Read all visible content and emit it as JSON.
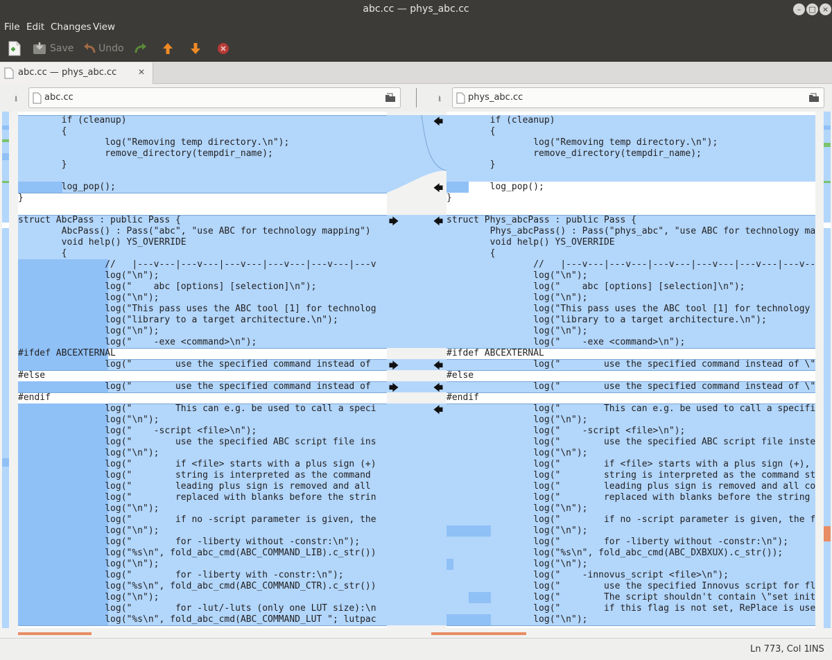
{
  "window": {
    "title": "abc.cc — phys_abc.cc"
  },
  "menu": {
    "file": "File",
    "edit": "Edit",
    "changes": "Changes",
    "view": "View"
  },
  "toolbar": {
    "save": "Save",
    "undo": "Undo"
  },
  "tab": {
    "label": "abc.cc — phys_abc.cc"
  },
  "left_file": {
    "name": "abc.cc"
  },
  "right_file": {
    "name": "phys_abc.cc"
  },
  "left_lines": [
    "        if (cleanup)",
    "        {",
    "                log(\"Removing temp directory.\\n\");",
    "                remove_directory(tempdir_name);",
    "        }",
    "",
    "        log_pop();",
    "}",
    "",
    "struct AbcPass : public Pass {",
    "        AbcPass() : Pass(\"abc\", \"use ABC for technology mapping\")",
    "        void help() YS_OVERRIDE",
    "        {",
    "                //   |---v---|---v---|---v---|---v---|---v---|---v",
    "                log(\"\\n\");",
    "                log(\"    abc [options] [selection]\\n\");",
    "                log(\"\\n\");",
    "                log(\"This pass uses the ABC tool [1] for technolog",
    "                log(\"library to a target architecture.\\n\");",
    "                log(\"\\n\");",
    "                log(\"    -exe <command>\\n\");",
    "#ifdef ABCEXTERNAL",
    "                log(\"        use the specified command instead of",
    "#else",
    "                log(\"        use the specified command instead of",
    "#endif",
    "                log(\"        This can e.g. be used to call a speci",
    "                log(\"\\n\");",
    "                log(\"    -script <file>\\n\");",
    "                log(\"        use the specified ABC script file ins",
    "                log(\"\\n\");",
    "                log(\"        if <file> starts with a plus sign (+)",
    "                log(\"        string is interpreted as the command",
    "                log(\"        leading plus sign is removed and all",
    "                log(\"        replaced with blanks before the strin",
    "                log(\"\\n\");",
    "                log(\"        if no -script parameter is given, the",
    "                log(\"\\n\");",
    "                log(\"        for -liberty without -constr:\\n\");",
    "                log(\"%s\\n\", fold_abc_cmd(ABC_COMMAND_LIB).c_str())",
    "                log(\"\\n\");",
    "                log(\"        for -liberty with -constr:\\n\");",
    "                log(\"%s\\n\", fold_abc_cmd(ABC_COMMAND_CTR).c_str())",
    "                log(\"\\n\");",
    "                log(\"        for -lut/-luts (only one LUT size):\\n",
    "                log(\"%s\\n\", fold_abc_cmd(ABC_COMMAND_LUT \"; lutpac"
  ],
  "right_lines": [
    "        if (cleanup)",
    "        {",
    "                log(\"Removing temp directory.\\n\");",
    "                remove_directory(tempdir_name);",
    "        }",
    "",
    "        log_pop();",
    "}",
    "",
    "struct Phys_abcPass : public Pass {",
    "        Phys_abcPass() : Pass(\"phys_abc\", \"use ABC for technology mapp",
    "        void help() YS_OVERRIDE",
    "        {",
    "                //   |---v---|---v---|---v---|---v---|---v---|---v---|---v",
    "                log(\"\\n\");",
    "                log(\"    abc [options] [selection]\\n\");",
    "                log(\"\\n\");",
    "                log(\"This pass uses the ABC tool [1] for technology mappin",
    "                log(\"library to a target architecture.\\n\");",
    "                log(\"\\n\");",
    "                log(\"    -exe <command>\\n\");",
    "#ifdef ABCEXTERNAL",
    "                log(\"        use the specified command instead of \\\"\" ABCE",
    "#else",
    "                log(\"        use the specified command instead of \\\"<yosys",
    "#endif",
    "                log(\"        This can e.g. be used to call a specific vers",
    "                log(\"\\n\");",
    "                log(\"    -script <file>\\n\");",
    "                log(\"        use the specified ABC script file instead of",
    "                log(\"\\n\");",
    "                log(\"        if <file> starts with a plus sign (+), then t",
    "                log(\"        string is interpreted as the command string t",
    "                log(\"        leading plus sign is removed and all commas (",
    "                log(\"        replaced with blanks before the string is pas",
    "                log(\"\\n\");",
    "                log(\"        if no -script parameter is given, the followi",
    "                log(\"\\n\");",
    "                log(\"        for -liberty without -constr:\\n\");",
    "                log(\"%s\\n\", fold_abc_cmd(ABC_DXBXUX).c_str());",
    "                log(\"\\n\");",
    "                log(\"    -innovus_script <file>\\n\");",
    "                log(\"        use the specified Innovus script for floor pl",
    "                log(\"        The script shouldn't contain \\\"set init_veril",
    "                log(\"        if this flag is not set, RePlace is used inst",
    "                log(\"\\n\");"
  ],
  "status": {
    "position": "Ln 773, Col 1",
    "mode": "INS"
  }
}
